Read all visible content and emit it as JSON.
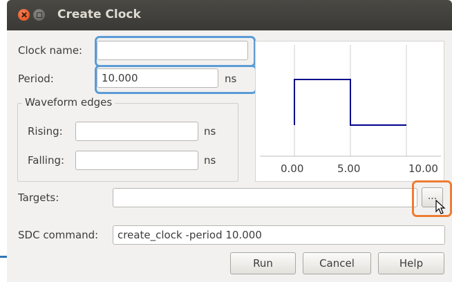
{
  "window": {
    "title": "Create Clock"
  },
  "form": {
    "clock_name_label": "Clock name:",
    "clock_name_value": "",
    "period_label": "Period:",
    "period_value": "10.000",
    "period_unit": "ns",
    "waveform_group": "Waveform edges",
    "rising_label": "Rising:",
    "rising_value": "",
    "rising_unit": "ns",
    "falling_label": "Falling:",
    "falling_value": "",
    "falling_unit": "ns",
    "targets_label": "Targets:",
    "targets_value": "",
    "targets_browse_label": "...",
    "sdc_label": "SDC command:",
    "sdc_value": "create_clock -period 10.000"
  },
  "waveform": {
    "ticks": [
      "0.00",
      "5.00",
      "10.00"
    ],
    "line_color": "#00008b"
  },
  "buttons": {
    "run": "Run",
    "cancel": "Cancel",
    "help": "Help"
  },
  "highlight_colors": {
    "blue": "#5b9bd5",
    "orange": "#ed7d31"
  }
}
